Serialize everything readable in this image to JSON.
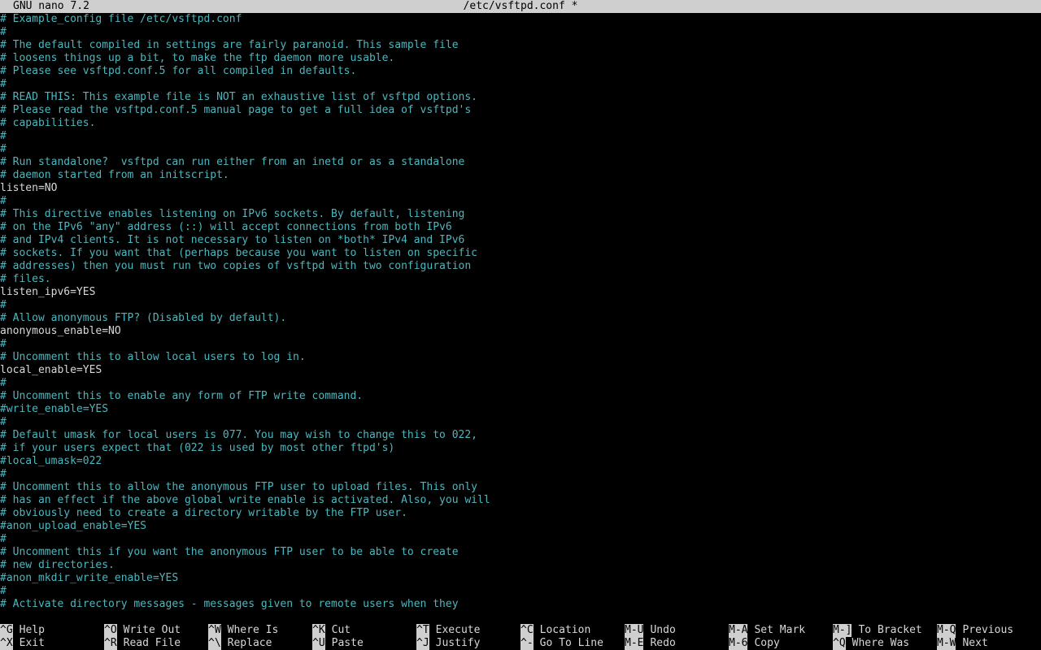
{
  "titlebar": {
    "app": "GNU nano 7.2",
    "file": "/etc/vsftpd.conf *"
  },
  "editor": {
    "lines": [
      {
        "text": "# Example_config file /etc/vsftpd.conf",
        "kind": "comment"
      },
      {
        "text": "#",
        "kind": "comment"
      },
      {
        "text": "# The default compiled in settings are fairly paranoid. This sample file",
        "kind": "comment"
      },
      {
        "text": "# loosens things up a bit, to make the ftp daemon more usable.",
        "kind": "comment"
      },
      {
        "text": "# Please see vsftpd.conf.5 for all compiled in defaults.",
        "kind": "comment"
      },
      {
        "text": "#",
        "kind": "comment"
      },
      {
        "text": "# READ THIS: This example file is NOT an exhaustive list of vsftpd options.",
        "kind": "comment"
      },
      {
        "text": "# Please read the vsftpd.conf.5 manual page to get a full idea of vsftpd's",
        "kind": "comment"
      },
      {
        "text": "# capabilities.",
        "kind": "comment"
      },
      {
        "text": "#",
        "kind": "comment"
      },
      {
        "text": "#",
        "kind": "comment"
      },
      {
        "text": "# Run standalone?  vsftpd can run either from an inetd or as a standalone",
        "kind": "comment"
      },
      {
        "text": "# daemon started from an initscript.",
        "kind": "comment"
      },
      {
        "text": "listen=NO",
        "kind": "setting"
      },
      {
        "text": "#",
        "kind": "comment"
      },
      {
        "text": "# This directive enables listening on IPv6 sockets. By default, listening",
        "kind": "comment"
      },
      {
        "text": "# on the IPv6 \"any\" address (::) will accept connections from both IPv6",
        "kind": "comment"
      },
      {
        "text": "# and IPv4 clients. It is not necessary to listen on *both* IPv4 and IPv6",
        "kind": "comment"
      },
      {
        "text": "# sockets. If you want that (perhaps because you want to listen on specific",
        "kind": "comment"
      },
      {
        "text": "# addresses) then you must run two copies of vsftpd with two configuration",
        "kind": "comment"
      },
      {
        "text": "# files.",
        "kind": "comment"
      },
      {
        "text": "listen_ipv6=YES",
        "kind": "setting"
      },
      {
        "text": "#",
        "kind": "comment"
      },
      {
        "text": "# Allow anonymous FTP? (Disabled by default).",
        "kind": "comment"
      },
      {
        "text": "anonymous_enable=NO",
        "kind": "setting"
      },
      {
        "text": "#",
        "kind": "comment"
      },
      {
        "text": "# Uncomment this to allow local users to log in.",
        "kind": "comment"
      },
      {
        "text": "local_enable=YES",
        "kind": "setting"
      },
      {
        "text": "#",
        "kind": "comment"
      },
      {
        "text": "# Uncomment this to enable any form of FTP write command.",
        "kind": "comment"
      },
      {
        "text": "#write_enable=YES",
        "kind": "comment"
      },
      {
        "text": "#",
        "kind": "comment"
      },
      {
        "text": "# Default umask for local users is 077. You may wish to change this to 022,",
        "kind": "comment"
      },
      {
        "text": "# if your users expect that (022 is used by most other ftpd's)",
        "kind": "comment"
      },
      {
        "text": "#local_umask=022",
        "kind": "comment"
      },
      {
        "text": "#",
        "kind": "comment"
      },
      {
        "text": "# Uncomment this to allow the anonymous FTP user to upload files. This only",
        "kind": "comment"
      },
      {
        "text": "# has an effect if the above global write enable is activated. Also, you will",
        "kind": "comment"
      },
      {
        "text": "# obviously need to create a directory writable by the FTP user.",
        "kind": "comment"
      },
      {
        "text": "#anon_upload_enable=YES",
        "kind": "comment"
      },
      {
        "text": "#",
        "kind": "comment"
      },
      {
        "text": "# Uncomment this if you want the anonymous FTP user to be able to create",
        "kind": "comment"
      },
      {
        "text": "# new directories.",
        "kind": "comment"
      },
      {
        "text": "#anon_mkdir_write_enable=YES",
        "kind": "comment"
      },
      {
        "text": "#",
        "kind": "comment"
      },
      {
        "text": "# Activate directory messages - messages given to remote users when they",
        "kind": "comment"
      }
    ]
  },
  "shortcuts": [
    {
      "key": "^G",
      "label": "Help"
    },
    {
      "key": "^X",
      "label": "Exit"
    },
    {
      "key": "^O",
      "label": "Write Out"
    },
    {
      "key": "^R",
      "label": "Read File"
    },
    {
      "key": "^W",
      "label": "Where Is"
    },
    {
      "key": "^\\",
      "label": "Replace"
    },
    {
      "key": "^K",
      "label": "Cut"
    },
    {
      "key": "^U",
      "label": "Paste"
    },
    {
      "key": "^T",
      "label": "Execute"
    },
    {
      "key": "^J",
      "label": "Justify"
    },
    {
      "key": "^C",
      "label": "Location"
    },
    {
      "key": "^-",
      "label": "Go To Line"
    },
    {
      "key": "M-U",
      "label": "Undo"
    },
    {
      "key": "M-E",
      "label": "Redo"
    },
    {
      "key": "M-A",
      "label": "Set Mark"
    },
    {
      "key": "M-6",
      "label": "Copy"
    },
    {
      "key": "M-]",
      "label": "To Bracket"
    },
    {
      "key": "^Q",
      "label": "Where Was"
    },
    {
      "key": "M-Q",
      "label": "Previous"
    },
    {
      "key": "M-W",
      "label": "Next"
    }
  ],
  "colors": {
    "comment": "#4fb6be",
    "setting": "#d8d8d8",
    "bar": "#cfcfcf",
    "background": "#000000"
  }
}
